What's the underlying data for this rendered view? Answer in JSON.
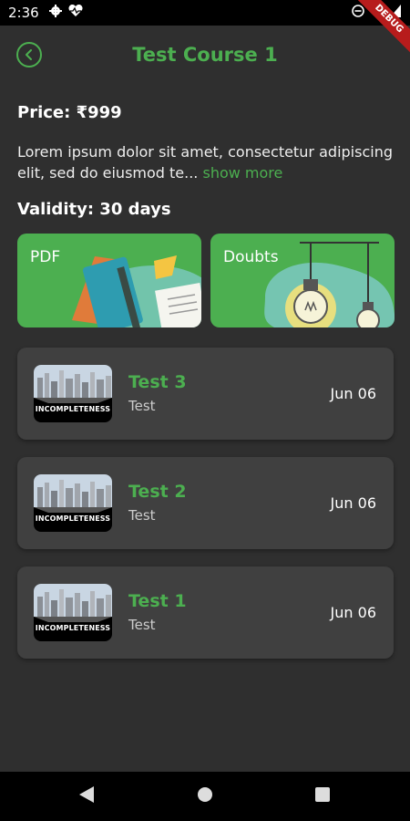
{
  "status_bar": {
    "time": "2:36"
  },
  "debug_banner": "DEBUG",
  "app_bar": {
    "title": "Test Course 1"
  },
  "course": {
    "price_label": "Price: ₹999",
    "description": "Lorem ipsum dolor sit amet, consectetur adipiscing elit, sed do eiusmod te...",
    "show_more": " show more",
    "validity_label": "Validity: 30 days"
  },
  "tiles": [
    {
      "label": "PDF",
      "icon": "notebook-illustration"
    },
    {
      "label": "Doubts",
      "icon": "lightbulb-illustration"
    }
  ],
  "tests": [
    {
      "title": "Test 3",
      "subtitle": "Test",
      "date": "Jun 06",
      "thumbnail_caption": "INCOMPLETENESS"
    },
    {
      "title": "Test 2",
      "subtitle": "Test",
      "date": "Jun 06",
      "thumbnail_caption": "INCOMPLETENESS"
    },
    {
      "title": "Test 1",
      "subtitle": "Test",
      "date": "Jun 06",
      "thumbnail_caption": "INCOMPLETENESS"
    }
  ],
  "colors": {
    "accent": "#4caf50",
    "background": "#2f2f2f",
    "card": "#404040"
  }
}
